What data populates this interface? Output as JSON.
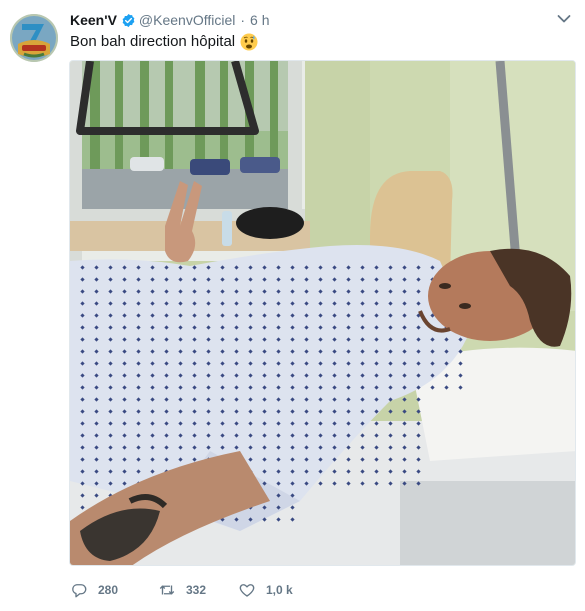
{
  "tweet": {
    "display_name": "Keen'V",
    "handle": "@KeenvOfficiel",
    "separator": "·",
    "time": "6 h",
    "text": "Bon bah direction hôpital",
    "emoji": "worried-face-emoji",
    "verified": true,
    "actions": {
      "reply_count": "280",
      "retweet_count": "332",
      "like_count": "1,0 k"
    },
    "icons": {
      "avatar": "avatar-image",
      "verified": "verified-badge-icon",
      "menu": "chevron-down-icon",
      "reply": "reply-icon",
      "retweet": "retweet-icon",
      "like": "heart-icon"
    }
  },
  "colors": {
    "text_primary": "#14171a",
    "text_secondary": "#657786",
    "verified_blue": "#1da1f2",
    "border": "#e1e8ed"
  }
}
